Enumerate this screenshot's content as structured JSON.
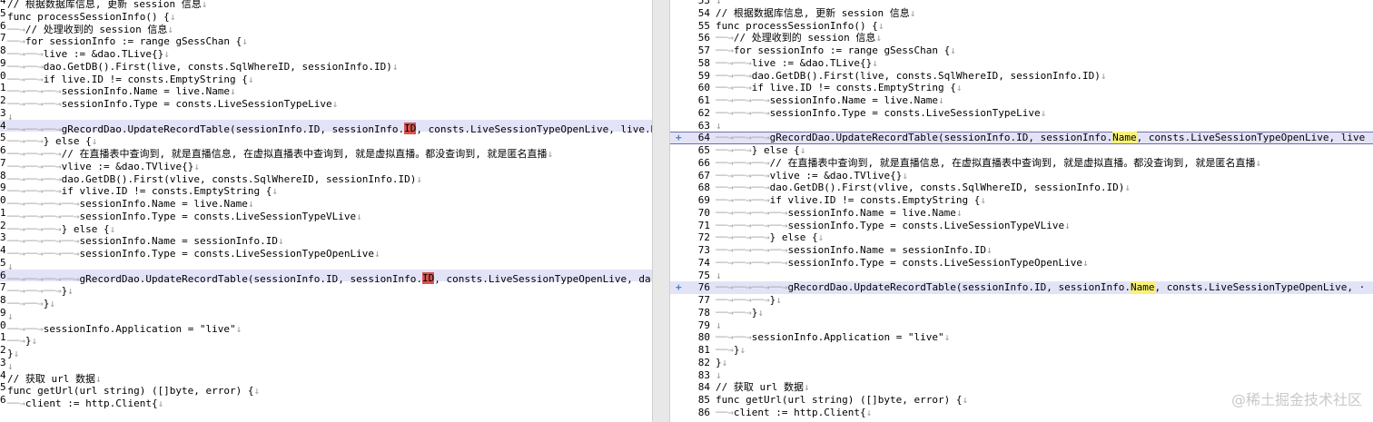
{
  "left": {
    "lines": [
      {
        "n": "4",
        "t": "// 根据数据库信息, 更新 session 信息↓"
      },
      {
        "n": "5",
        "t": "func processSessionInfo() {↓"
      },
      {
        "n": "6",
        "t": "──→// 处理收到的 session 信息↓"
      },
      {
        "n": "7",
        "t": "──→for sessionInfo := range gSessChan {↓"
      },
      {
        "n": "8",
        "t": "──→──→live := &dao.TLive{}↓"
      },
      {
        "n": "9",
        "t": "──→──→dao.GetDB().First(live, consts.SqlWhereID, sessionInfo.ID)↓"
      },
      {
        "n": "0",
        "t": "──→──→if live.ID != consts.EmptyString {↓"
      },
      {
        "n": "1",
        "t": "──→──→──→sessionInfo.Name = live.Name↓"
      },
      {
        "n": "2",
        "t": "──→──→──→sessionInfo.Type = consts.LiveSessionTypeLive↓"
      },
      {
        "n": "3",
        "t": "↓"
      },
      {
        "n": "4",
        "t": "──→──→──→gRecordDao.UpdateRecordTable(sessionInfo.ID, sessionInfo.ID, consts.LiveSessionTypeOpenLive, live.R",
        "changed": true,
        "hl": "ID"
      },
      {
        "n": "5",
        "t": "──→──→} else {↓"
      },
      {
        "n": "6",
        "t": "──→──→──→// 在直播表中查询到, 就是直播信息, 在虚拟直播表中查询到, 就是虚拟直播。都没查询到, 就是匿名直播↓"
      },
      {
        "n": "7",
        "t": "──→──→──→vlive := &dao.TVlive{}↓"
      },
      {
        "n": "8",
        "t": "──→──→──→dao.GetDB().First(vlive, consts.SqlWhereID, sessionInfo.ID)↓"
      },
      {
        "n": "9",
        "t": "──→──→──→if vlive.ID != consts.EmptyString {↓"
      },
      {
        "n": "0",
        "t": "──→──→──→──→sessionInfo.Name = live.Name↓"
      },
      {
        "n": "1",
        "t": "──→──→──→──→sessionInfo.Type = consts.LiveSessionTypeVLive↓"
      },
      {
        "n": "2",
        "t": "──→──→──→} else {↓"
      },
      {
        "n": "3",
        "t": "──→──→──→──→sessionInfo.Name = sessionInfo.ID↓"
      },
      {
        "n": "4",
        "t": "──→──→──→──→sessionInfo.Type = consts.LiveSessionTypeOpenLive↓"
      },
      {
        "n": "5",
        "t": "↓"
      },
      {
        "n": "6",
        "t": "──→──→──→──→gRecordDao.UpdateRecordTable(sessionInfo.ID, sessionInfo.ID, consts.LiveSessionTypeOpenLive, da",
        "changed": true,
        "hl": "ID"
      },
      {
        "n": "7",
        "t": "──→──→──→}↓"
      },
      {
        "n": "8",
        "t": "──→──→}↓"
      },
      {
        "n": "9",
        "t": "↓"
      },
      {
        "n": "0",
        "t": "──→──→sessionInfo.Application = \"live\"↓"
      },
      {
        "n": "1",
        "t": "──→}↓"
      },
      {
        "n": "2",
        "t": "}↓"
      },
      {
        "n": "3",
        "t": "↓"
      },
      {
        "n": "4",
        "t": "// 获取 url 数据↓"
      },
      {
        "n": "5",
        "t": "func getUrl(url string) ([]byte, error) {↓"
      },
      {
        "n": "6",
        "t": "──→client := http.Client{↓"
      }
    ]
  },
  "right": {
    "lines": [
      {
        "n": "53",
        "t": "↓"
      },
      {
        "n": "54",
        "t": "// 根据数据库信息, 更新 session 信息↓"
      },
      {
        "n": "55",
        "t": "func processSessionInfo() {↓"
      },
      {
        "n": "56",
        "t": "──→// 处理收到的 session 信息↓"
      },
      {
        "n": "57",
        "t": "──→for sessionInfo := range gSessChan {↓"
      },
      {
        "n": "58",
        "t": "──→──→live := &dao.TLive{}↓"
      },
      {
        "n": "59",
        "t": "──→──→dao.GetDB().First(live, consts.SqlWhereID, sessionInfo.ID)↓"
      },
      {
        "n": "60",
        "t": "──→──→if live.ID != consts.EmptyString {↓"
      },
      {
        "n": "61",
        "t": "──→──→──→sessionInfo.Name = live.Name↓"
      },
      {
        "n": "62",
        "t": "──→──→──→sessionInfo.Type = consts.LiveSessionTypeLive↓"
      },
      {
        "n": "63",
        "t": "↓"
      },
      {
        "n": "64",
        "t": "──→──→──→gRecordDao.UpdateRecordTable(sessionInfo.ID, sessionInfo.Name, consts.LiveSessionTypeOpenLive, live",
        "changed": true,
        "outlined": true,
        "mark": "+",
        "hl": "Name"
      },
      {
        "n": "65",
        "t": "──→──→} else {↓"
      },
      {
        "n": "66",
        "t": "──→──→──→// 在直播表中查询到, 就是直播信息, 在虚拟直播表中查询到, 就是虚拟直播。都没查询到, 就是匿名直播↓"
      },
      {
        "n": "67",
        "t": "──→──→──→vlive := &dao.TVlive{}↓"
      },
      {
        "n": "68",
        "t": "──→──→──→dao.GetDB().First(vlive, consts.SqlWhereID, sessionInfo.ID)↓"
      },
      {
        "n": "69",
        "t": "──→──→──→if vlive.ID != consts.EmptyString {↓"
      },
      {
        "n": "70",
        "t": "──→──→──→──→sessionInfo.Name = live.Name↓"
      },
      {
        "n": "71",
        "t": "──→──→──→──→sessionInfo.Type = consts.LiveSessionTypeVLive↓"
      },
      {
        "n": "72",
        "t": "──→──→──→} else {↓"
      },
      {
        "n": "73",
        "t": "──→──→──→──→sessionInfo.Name = sessionInfo.ID↓"
      },
      {
        "n": "74",
        "t": "──→──→──→──→sessionInfo.Type = consts.LiveSessionTypeOpenLive↓"
      },
      {
        "n": "75",
        "t": "↓"
      },
      {
        "n": "76",
        "t": "──→──→──→──→gRecordDao.UpdateRecordTable(sessionInfo.ID, sessionInfo.Name, consts.LiveSessionTypeOpenLive, ·",
        "changed": true,
        "mark": "+",
        "hl": "Name"
      },
      {
        "n": "77",
        "t": "──→──→──→}↓"
      },
      {
        "n": "78",
        "t": "──→──→}↓"
      },
      {
        "n": "79",
        "t": "↓"
      },
      {
        "n": "80",
        "t": "──→──→sessionInfo.Application = \"live\"↓"
      },
      {
        "n": "81",
        "t": "──→}↓"
      },
      {
        "n": "82",
        "t": "}↓"
      },
      {
        "n": "83",
        "t": "↓"
      },
      {
        "n": "84",
        "t": "// 获取 url 数据↓"
      },
      {
        "n": "85",
        "t": "func getUrl(url string) ([]byte, error) {↓"
      },
      {
        "n": "86",
        "t": "──→client := http.Client{↓"
      }
    ]
  },
  "watermark": "@稀土掘金技术社区",
  "colors": {
    "changed_bg": "#e3e3f8",
    "deleted_hl": "#d9534f",
    "added_hl": "#f8f17a",
    "marker": "#3f84c8"
  }
}
